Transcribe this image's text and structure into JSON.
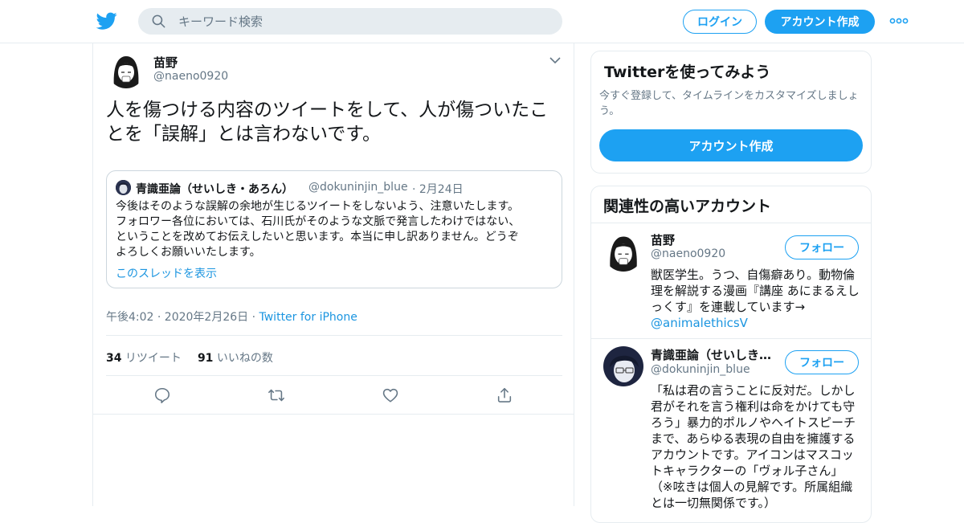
{
  "header": {
    "logo_icon": "twitter-bird-icon",
    "search_placeholder": "キーワード検索",
    "login_label": "ログイン",
    "signup_label": "アカウント作成",
    "more_icon": "more-dots-icon",
    "brand_color": "#1da1f2"
  },
  "tweet": {
    "author_name": "苗野",
    "author_handle": "@naeno0920",
    "text_line1": "人を傷つける内容のツイートをして、人が傷ついたこ",
    "text_line2": "とを「誤解」とは言わないです。",
    "quote": {
      "author_name": "青識亜論（せいしき・あろん）",
      "author_handle": "@dokuninjin_blue",
      "date": "· 2月24日",
      "line1": "今後はそのような誤解の余地が生じるツイートをしないよう、注意いたします。",
      "line2": "フォロワー各位においては、石川氏がそのような文脈で発言したわけではない、",
      "line3": "ということを改めてお伝えしたいと思います。本当に申し訳ありません。どうぞ",
      "line4": "よろしくお願いいたします。",
      "thread_link": "このスレッドを表示"
    },
    "timestamp": "午後4:02 · 2020年2月26日 · ",
    "source": "Twitter for iPhone",
    "retweet_count": "34",
    "retweet_label": " リツイート",
    "like_count": "91",
    "like_label": " いいねの数",
    "actions": [
      "reply-icon",
      "retweet-icon",
      "like-icon",
      "share-icon"
    ]
  },
  "sidebar": {
    "signup_card": {
      "title": "Twitterを使ってみよう",
      "description_line1": "今すぐ登録して、タイムラインをカスタマイズしましょ",
      "description_line2": "う。",
      "button_label": "アカウント作成"
    },
    "related": {
      "title": "関連性の高いアカウント",
      "accounts": [
        {
          "name": "苗野",
          "handle": "@naeno0920",
          "follow_label": "フォロー",
          "bio_lines": [
            "獣医学生。うつ、自傷癖あり。動物倫",
            "理を解説する漫画『講座 あにまるえし",
            "っくす』を連載しています→"
          ],
          "bio_link": "@animalethicsV"
        },
        {
          "name": "青識亜論（せいしきあろん）",
          "handle": "@dokuninjin_blue",
          "follow_label": "フォロー",
          "bio_lines": [
            "「私は君の言うことに反対だ。しかし",
            "君がそれを言う権利は命をかけても守",
            "ろう」暴力的ポルノやヘイトスピーチ",
            "まで、あらゆる表現の自由を擁護する",
            "アカウントです。アイコンはマスコッ",
            "トキャラクターの「ヴォル子さん」",
            "（※呟きは個人の見解です。所属組織",
            "とは一切無関係です。）"
          ]
        }
      ]
    }
  }
}
